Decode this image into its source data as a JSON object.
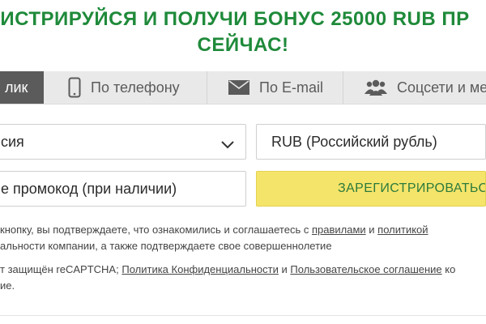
{
  "headline": {
    "line1": "ИСТРИРУЙСЯ И ПОЛУЧИ БОНУС 25000 RUB ПР",
    "line2": "СЕЙЧАС!"
  },
  "tabs": [
    {
      "label": "лик",
      "icon": "none",
      "active": true
    },
    {
      "label": "По телефону",
      "icon": "phone-icon",
      "active": false
    },
    {
      "label": "По E-mail",
      "icon": "envelope-icon",
      "active": false
    },
    {
      "label": "Соцсети и ме",
      "icon": "users-icon",
      "active": false
    }
  ],
  "form": {
    "country_value": "сия",
    "currency_value": "RUB (Российский рубль)",
    "promo_placeholder": "е промокод (при наличии)",
    "register_label": "ЗАРЕГИСТРИРОВАТЬСЯ"
  },
  "legal": {
    "line1_prefix": "кнопку, вы подтверждаете, что ознакомились и соглашаетесь с",
    "rules_link": "правилами",
    "and1": "и",
    "policy_link": "политикой",
    "line2": "альности компании, а также подтверждаете свое совершеннолетие",
    "line3_prefix": "т защищён reCAPTCHA;",
    "privacy_link": "Политика Конфиденциальности",
    "and2": "и",
    "terms_link": "Пользовательское соглашение",
    "line3_suffix": "ко",
    "line4": "ие."
  },
  "colors": {
    "brand_green": "#1f8a3a",
    "button_yellow": "#f4e46a",
    "tab_active": "#5b5b5b",
    "tab_bg": "#e9e9e9"
  }
}
